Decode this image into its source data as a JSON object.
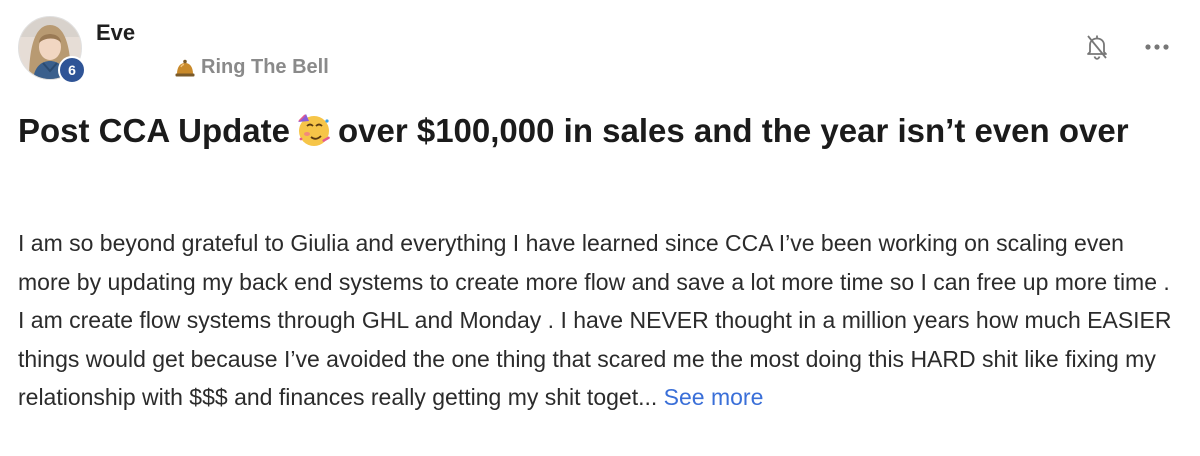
{
  "post": {
    "author": {
      "name": "Eve",
      "level": "6"
    },
    "category": {
      "label": "Ring The Bell",
      "icon": "bell-icon"
    },
    "actions": {
      "notify_icon": "bell-off-icon",
      "more_icon": "more-horizontal-icon"
    },
    "title": {
      "part1": "Post CCA Update",
      "emoji": "partying-face-emoji",
      "part2": "over $100,000 in sales and the year isn’t even over"
    },
    "body": {
      "text": "I am so beyond grateful to Giulia and everything I have learned since CCA I’ve been working on scaling even more by updating my back end systems to create more flow and save a lot more time so I can free up more time . I am create flow systems through GHL and Monday . I have NEVER thought in a million years how much EASIER things would get because I’ve avoided the one thing that scared me the most doing this HARD shit like fixing my relationship with $$$ and finances really getting my shit toget...",
      "see_more": "See more"
    },
    "colors": {
      "badge": "#2f5496",
      "link": "#3a6fd8",
      "category": "#8a8a8a"
    }
  }
}
